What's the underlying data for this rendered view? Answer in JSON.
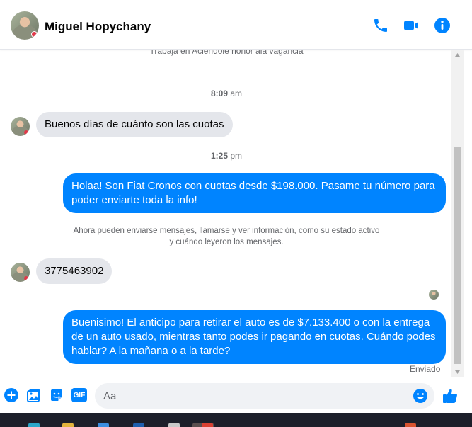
{
  "header": {
    "contact_name": "Miguel Hopychany",
    "icons": [
      "phone-icon",
      "video-camera-icon",
      "info-icon"
    ]
  },
  "thread": {
    "profile_bio": "Trabaja en Aciendole honor ala vagancia",
    "items": [
      {
        "type": "timestamp",
        "time": "8:09",
        "unit": "am"
      },
      {
        "type": "incoming",
        "text": "Buenos días de cuánto son las cuotas"
      },
      {
        "type": "timestamp",
        "time": "1:25",
        "unit": "pm"
      },
      {
        "type": "outgoing",
        "text": "Holaa! Son Fiat Cronos con cuotas desde $198.000. Pasame tu número para poder enviarte toda la info!"
      },
      {
        "type": "system",
        "text": "Ahora pueden enviarse mensajes, llamarse y ver información, como su estado activo y cuándo leyeron los mensajes."
      },
      {
        "type": "incoming",
        "text": "3775463902"
      },
      {
        "type": "outgoing",
        "text": "Buenisimo! El anticipo para retirar el auto es de $7.133.400 o con la entrega de un auto usado, mientras tanto podes ir pagando en cuotas. Cuándo podes hablar? A la mañana o a la tarde?"
      }
    ],
    "sent_status": "Enviado"
  },
  "composer": {
    "placeholder": "Aa",
    "gif_label": "GIF",
    "icons": [
      "add-circle-icon",
      "photo-icon",
      "sticker-icon",
      "gif-icon",
      "emoji-icon",
      "thumbs-up-icon"
    ]
  },
  "colors": {
    "accent": "#0084ff",
    "incoming_bubble": "#e4e6eb",
    "secondary_text": "#65676b"
  }
}
